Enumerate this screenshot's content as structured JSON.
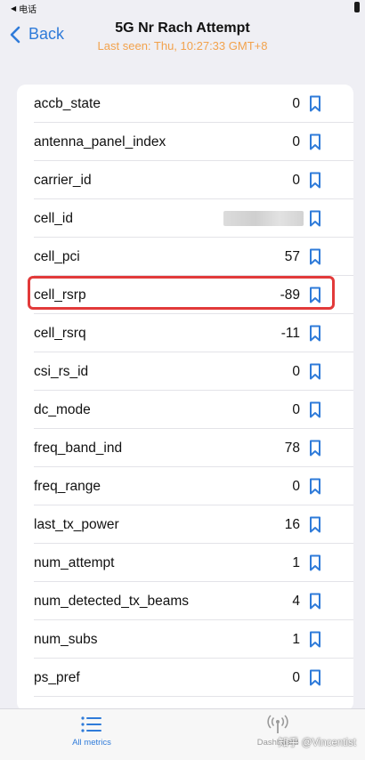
{
  "status_bar": {
    "carrier": "电话"
  },
  "nav": {
    "back_label": "Back",
    "title": "5G Nr Rach Attempt",
    "subtitle": "Last seen: Thu, 10:27:33 GMT+8"
  },
  "metrics": [
    {
      "label": "accb_state",
      "value": "0"
    },
    {
      "label": "antenna_panel_index",
      "value": "0"
    },
    {
      "label": "carrier_id",
      "value": "0"
    },
    {
      "label": "cell_id",
      "value": ""
    },
    {
      "label": "cell_pci",
      "value": "57"
    },
    {
      "label": "cell_rsrp",
      "value": "-89"
    },
    {
      "label": "cell_rsrq",
      "value": "-11"
    },
    {
      "label": "csi_rs_id",
      "value": "0"
    },
    {
      "label": "dc_mode",
      "value": "0"
    },
    {
      "label": "freq_band_ind",
      "value": "78"
    },
    {
      "label": "freq_range",
      "value": "0"
    },
    {
      "label": "last_tx_power",
      "value": "16"
    },
    {
      "label": "num_attempt",
      "value": "1"
    },
    {
      "label": "num_detected_tx_beams",
      "value": "4"
    },
    {
      "label": "num_subs",
      "value": "1"
    },
    {
      "label": "ps_pref",
      "value": "0"
    }
  ],
  "tabs": [
    {
      "label": "All metrics",
      "icon": "list-icon"
    },
    {
      "label": "Dashboard",
      "icon": "antenna-icon"
    }
  ],
  "watermark": "知乎 @Vincentist",
  "colors": {
    "accent": "#2f7bd9",
    "subtitle": "#f2a24c",
    "highlight": "#e23a3a"
  }
}
